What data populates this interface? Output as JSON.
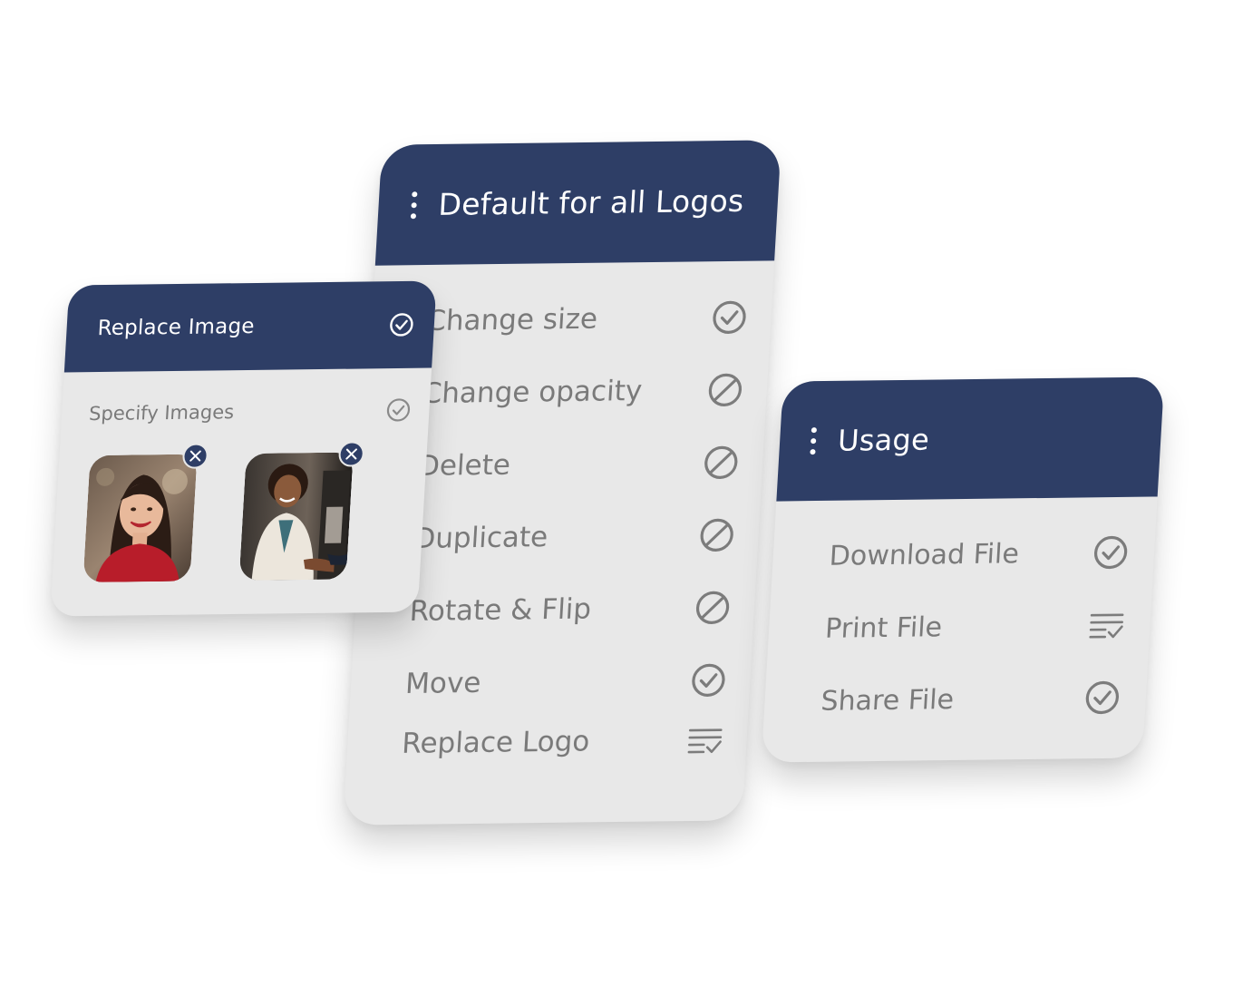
{
  "cards": {
    "replace_image": {
      "title": "Replace Image",
      "title_icon": "check-circle-icon",
      "rows": [
        {
          "label": "Specify Images",
          "icon": "check-circle-icon"
        }
      ],
      "images": [
        {
          "subject": "smiling woman in red top",
          "remove_icon": "close-icon"
        },
        {
          "subject": "businesswoman shaking hands",
          "remove_icon": "close-icon"
        }
      ]
    },
    "default_logos": {
      "title": "Default for all Logos",
      "menu_icon": "kebab-menu-icon",
      "rows": [
        {
          "label": "Change size",
          "icon": "check-circle-icon"
        },
        {
          "label": "Change opacity",
          "icon": "forbidden-icon"
        },
        {
          "label": "Delete",
          "icon": "forbidden-icon"
        },
        {
          "label": "Duplicate",
          "icon": "forbidden-icon"
        },
        {
          "label": "Rotate & Flip",
          "icon": "forbidden-icon"
        },
        {
          "label": "Move",
          "icon": "check-circle-icon"
        },
        {
          "label": "Replace Logo",
          "icon": "list-check-icon"
        }
      ]
    },
    "usage": {
      "title": "Usage",
      "menu_icon": "kebab-menu-icon",
      "rows": [
        {
          "label": "Download File",
          "icon": "check-circle-icon"
        },
        {
          "label": "Print File",
          "icon": "list-check-icon"
        },
        {
          "label": "Share File",
          "icon": "check-circle-icon"
        }
      ]
    }
  },
  "colors": {
    "header": "#2e3e66",
    "card_body": "#e8e8e8",
    "text_muted": "#7a7a7a",
    "background": "#ffffff"
  }
}
